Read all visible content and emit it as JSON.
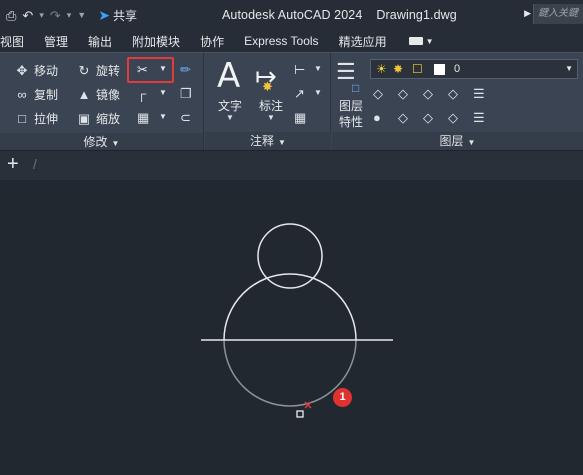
{
  "titlebar": {
    "share_label": "共享",
    "app_title": "Autodesk AutoCAD 2024",
    "document": "Drawing1.dwg",
    "search_placeholder": "鍵入关鍵"
  },
  "tabs": [
    "视图",
    "管理",
    "输出",
    "附加模块",
    "协作",
    "Express Tools",
    "精选应用"
  ],
  "ribbon": {
    "modify": {
      "move": "移动",
      "rotate": "旋转",
      "copy": "复制",
      "mirror": "镜像",
      "stretch": "拉伸",
      "scale": "缩放",
      "footer": "修改"
    },
    "annotation": {
      "text": "文字",
      "dimension": "标注",
      "footer": "注释"
    },
    "layers": {
      "layer_properties_line1": "图层",
      "layer_properties_line2": "特性",
      "current_layer": "0",
      "footer": "图层"
    }
  },
  "canvas": {
    "callout_number": "1"
  },
  "colors": {
    "highlight": "#e23b3b",
    "badge": "#e0332f",
    "background": "#212830",
    "ribbon": "#3b4453"
  }
}
